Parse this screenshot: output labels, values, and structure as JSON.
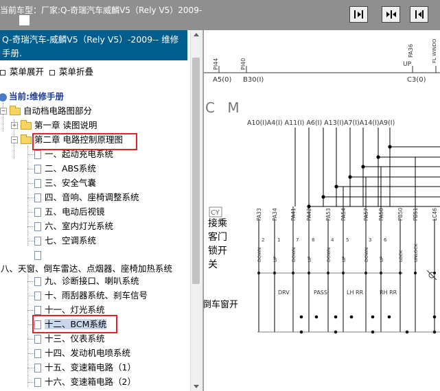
{
  "header": {
    "car_label": "当前车型：",
    "car_name": "厂家:Q-奇瑞汽车威麟V5（Rely V5）2009-",
    "buttons": [
      "expand-left",
      "split-both",
      "expand-right"
    ]
  },
  "left_panel": {
    "title": "Q-奇瑞汽车-威麟V5（Rely V5）-2009-- 维修手册.",
    "expand_all": "菜单展开",
    "collapse_all": "菜单折叠",
    "root": "当前:维修手册",
    "tree": [
      {
        "label": "自动档电路图部分",
        "type": "folder",
        "toggle": "−"
      },
      {
        "label": "第一章 读图说明",
        "type": "folder",
        "toggle": "+"
      },
      {
        "label": "第二章 电路控制原理图",
        "type": "folder",
        "toggle": "−",
        "highlight": true
      },
      {
        "label": "一、起动充电系统",
        "type": "doc"
      },
      {
        "label": "二、ABS系统",
        "type": "doc"
      },
      {
        "label": "三、安全气囊",
        "type": "doc"
      },
      {
        "label": "四、音响、座椅调整系统",
        "type": "doc"
      },
      {
        "label": "五、电动后视镜",
        "type": "doc"
      },
      {
        "label": "六、室内灯光系统",
        "type": "doc"
      },
      {
        "label": "七、空调系统",
        "type": "doc"
      },
      {
        "label": "",
        "type": "doc"
      },
      {
        "label": "八、天窗、倒车雷达、点烟器、座椅加热系统",
        "type": "text"
      },
      {
        "label": "九、诊断接口、喇叭系统",
        "type": "doc"
      },
      {
        "label": "十、雨刮器系统、刹车信号",
        "type": "doc"
      },
      {
        "label": "十一、灯光系统",
        "type": "doc"
      },
      {
        "label": "十二、BCM系统",
        "type": "doc",
        "selected": true,
        "highlight": true
      },
      {
        "label": "十三、仪表系统",
        "type": "doc"
      },
      {
        "label": "十四、发动机电喷系统",
        "type": "doc"
      },
      {
        "label": "十五、变速箱电路（1）",
        "type": "doc"
      },
      {
        "label": "十六、变速箱电路（2）",
        "type": "doc"
      }
    ]
  },
  "diagram": {
    "top_pins": [
      "PI44",
      "PI40",
      "PA36",
      "FL WINDO"
    ],
    "top_conn": [
      "A5(0)",
      "B30(I)",
      "UP",
      "C3(0)"
    ],
    "cm_label": "C M",
    "bus_labels": "A10(I)A4(I) A11(I) A6(I) A13(I)A7(I)A14(I)A9(I)",
    "cy_label": "CY",
    "side_text": [
      "接乘",
      "客门",
      "锁开",
      "关"
    ],
    "bottom_left_text": "倒车窗开",
    "pins": [
      "PA33",
      "PA34",
      "PA41",
      "PA42",
      "PA53",
      "PA54",
      "PA57",
      "PA58",
      "PB50",
      "PB51",
      "LC46"
    ],
    "pin_nums": [
      "2",
      "1",
      "7",
      "8",
      "4",
      "5",
      "3",
      "6"
    ],
    "pin_states": [
      "DOWN",
      "UP",
      "DOWN",
      "UP",
      "DOWN",
      "UP",
      "DOWN",
      "UP",
      "LOCK",
      "UNLOCK"
    ],
    "switch_labels": [
      "DRV",
      "PASS",
      "LH RR",
      "RH RR"
    ]
  }
}
